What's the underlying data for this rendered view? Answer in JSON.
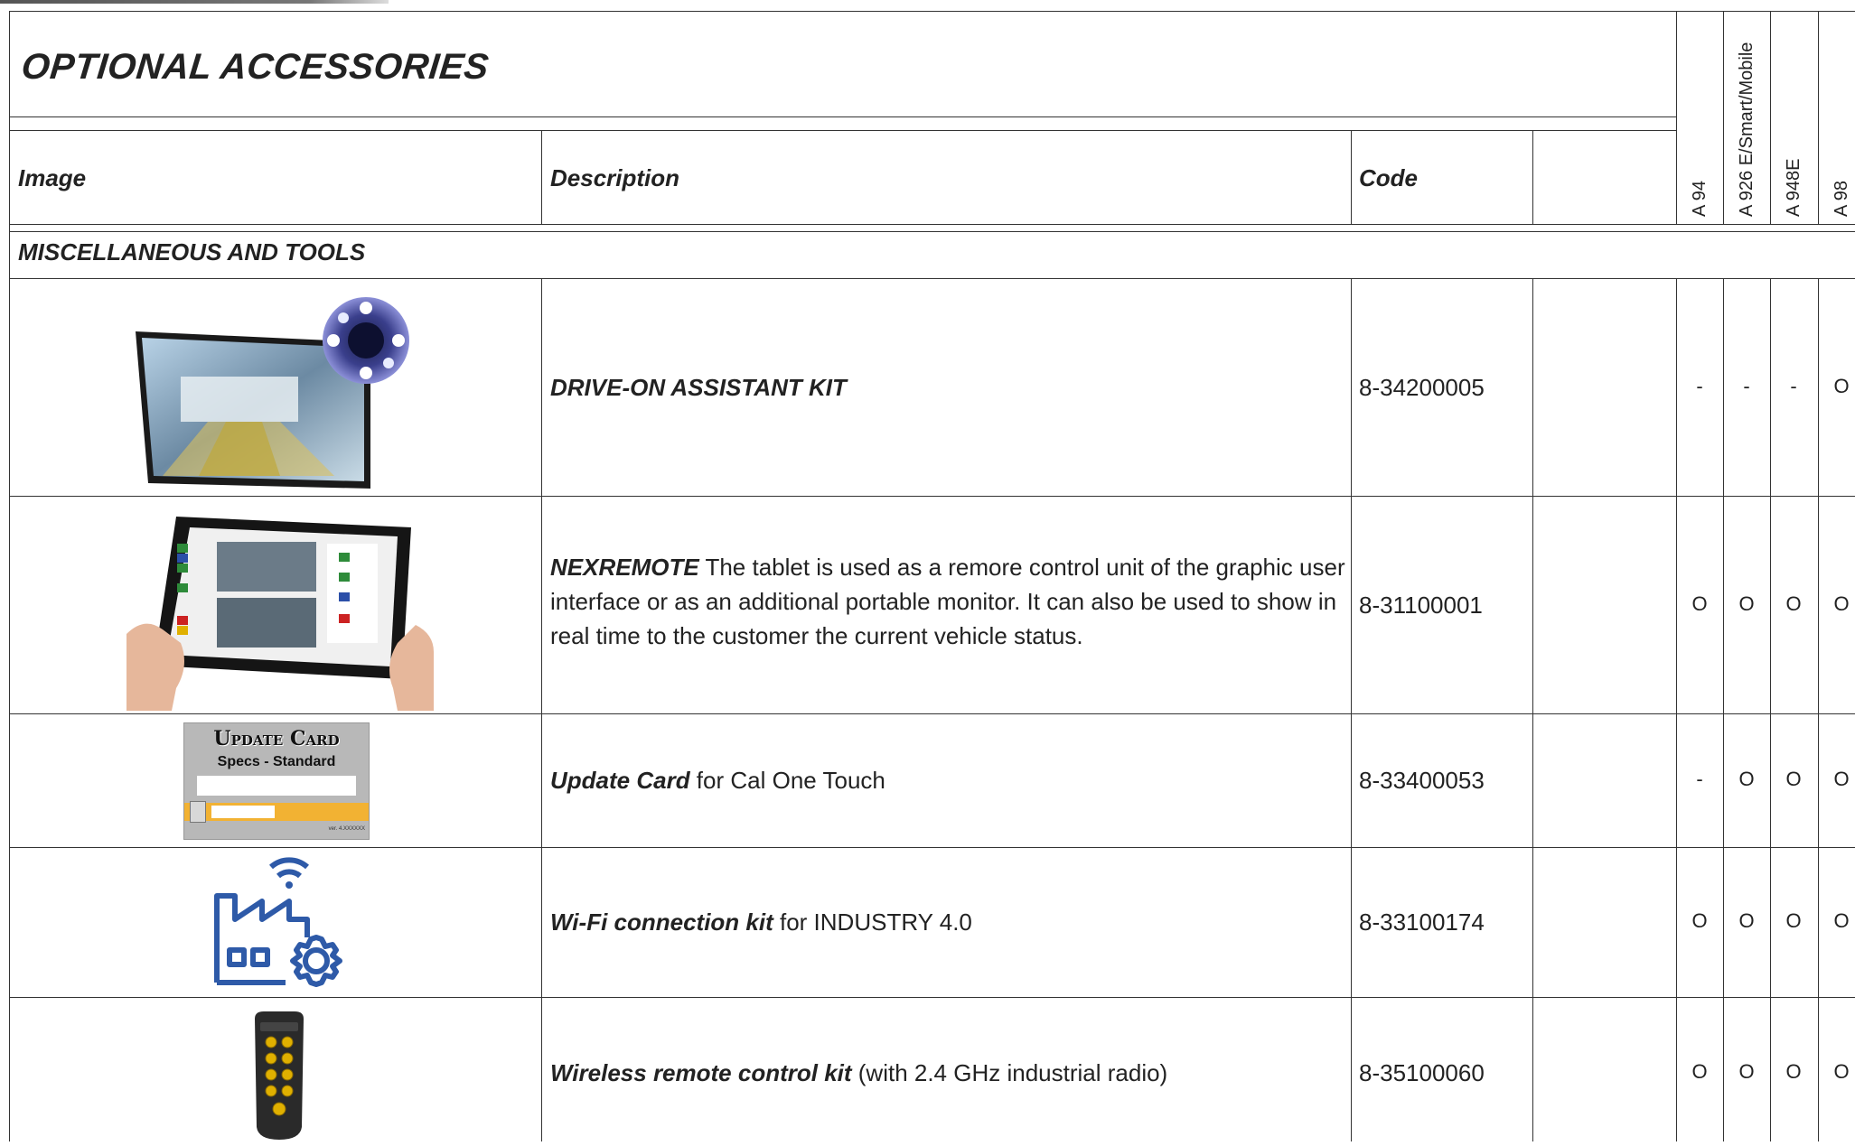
{
  "title": "OPTIONAL ACCESSORIES",
  "columns": {
    "image": "Image",
    "description": "Description",
    "code": "Code",
    "models": [
      "A 94",
      "A 926 E/Smart/Mobile",
      "A 948E",
      "A 98"
    ]
  },
  "section": "MISCELLANEOUS AND TOOLS",
  "rows": [
    {
      "name_bold": "DRIVE-ON ASSISTANT KIT",
      "description": "",
      "code": "8-34200005",
      "availability": [
        "-",
        "-",
        "-",
        "O"
      ]
    },
    {
      "name_bold": "NEXREMOTE",
      "description": " The tablet is used as a remore control unit of the graphic user interface or as an additional portable monitor. It can also be used to show in real time to the customer the current vehicle status.",
      "code": "8-31100001",
      "availability": [
        "O",
        "O",
        "O",
        "O"
      ]
    },
    {
      "name_bold": "Update Card",
      "description": " for Cal One Touch",
      "code": "8-33400053",
      "availability": [
        "-",
        "O",
        "O",
        "O"
      ],
      "image_text": {
        "line1": "Update Card",
        "line2": "Specs - Standard",
        "small": "ver. 4.XXXXXX"
      }
    },
    {
      "name_bold": "Wi-Fi connection kit",
      "description": " for INDUSTRY 4.0",
      "code": "8-33100174",
      "availability": [
        "O",
        "O",
        "O",
        "O"
      ]
    },
    {
      "name_bold": "Wireless remote control kit",
      "description": " (with 2.4 GHz industrial radio)",
      "code": "8-35100060",
      "availability": [
        "O",
        "O",
        "O",
        "O"
      ]
    }
  ],
  "colors": {
    "border": "#333333",
    "card_yellow": "#f2b233",
    "icon_blue": "#2e5aa8"
  }
}
